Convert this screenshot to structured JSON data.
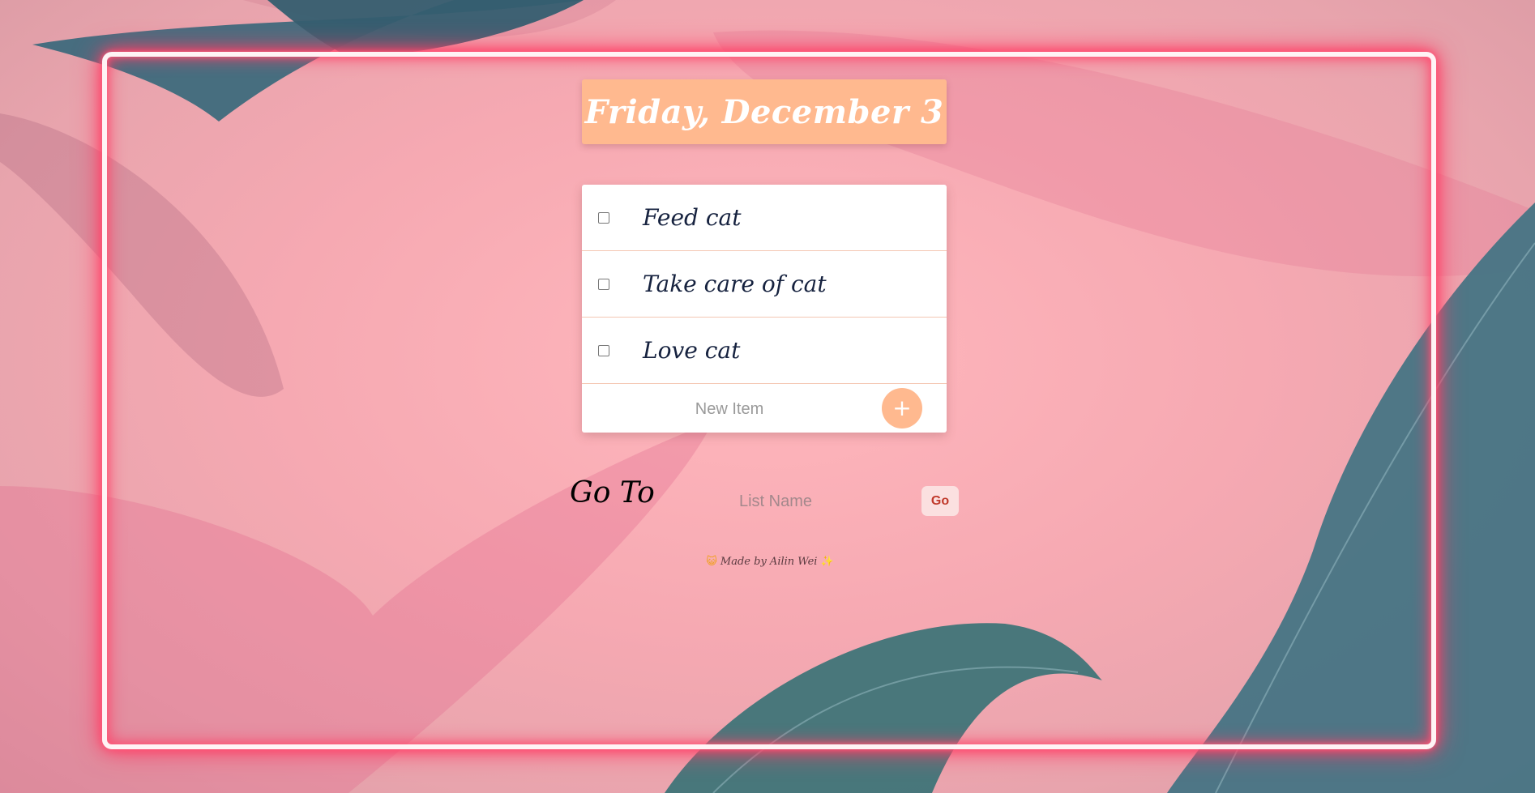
{
  "app": {
    "date_heading": "Friday, December 3"
  },
  "todo": {
    "items": [
      {
        "label": "Feed cat",
        "checked": false
      },
      {
        "label": "Take care of cat",
        "checked": false
      },
      {
        "label": "Love cat",
        "checked": false
      }
    ],
    "new_item_placeholder": "New Item",
    "add_button_label": "+"
  },
  "goto": {
    "label": "Go To",
    "list_name_placeholder": "List Name",
    "go_button_label": "Go"
  },
  "footer": {
    "left_emoji": "😺",
    "text": "Made by Ailin Wei",
    "right_emoji": "✨"
  },
  "colors": {
    "header_bg": "#ffb98f",
    "add_button_bg": "#ffb98f",
    "go_button_bg": "#fbe0e0",
    "go_button_text": "#c0392b",
    "neon_frame": "#ff3f67",
    "item_text": "#16223f"
  }
}
